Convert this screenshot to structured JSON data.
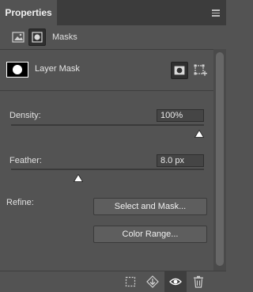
{
  "panel": {
    "tab_label": "Properties",
    "menu_icon": "hamburger-menu-icon"
  },
  "header": {
    "masks_label": "Masks",
    "pixel_icon": "pixel-properties-icon",
    "mask_icon": "mask-properties-icon"
  },
  "layer": {
    "label": "Layer Mask",
    "thumbnail_icon": "mask-thumbnail",
    "add_pixel_mask_icon": "pixel-mask-icon",
    "add_vector_mask_icon": "vector-mask-icon"
  },
  "density": {
    "label": "Density:",
    "value": "100%",
    "level": 1.0
  },
  "feather": {
    "label": "Feather:",
    "value": "8.0 px",
    "level": 0.35
  },
  "refine": {
    "label": "Refine:",
    "select_and_mask": "Select and Mask...",
    "color_range": "Color Range..."
  },
  "bottom": {
    "selection_icon": "load-selection-icon",
    "apply_mask_icon": "apply-mask-icon",
    "visibility_icon": "eye-icon",
    "delete_icon": "trash-icon"
  },
  "colors": {
    "panel_bg": "#535353",
    "tabbar_bg": "#3c3c3c",
    "text": "#e6e6e6"
  }
}
